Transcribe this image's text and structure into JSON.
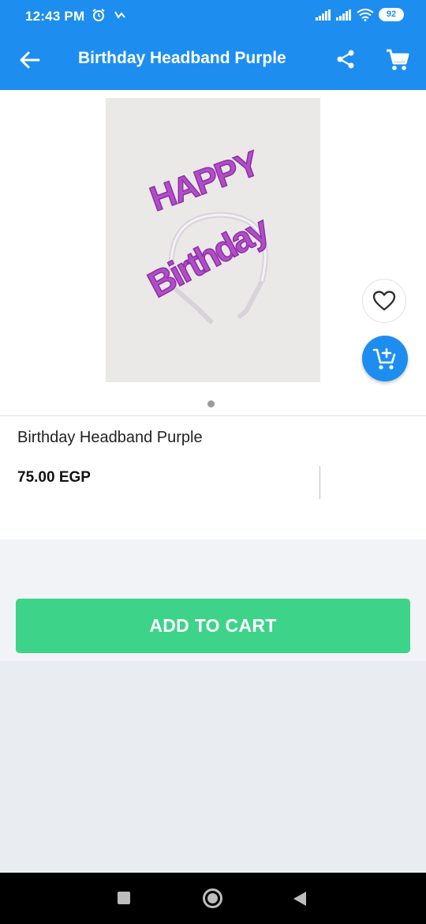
{
  "status_bar": {
    "time": "12:43 PM",
    "battery": "92",
    "icons": [
      "alarm-icon",
      "wifi-calling-icon",
      "signal-icon",
      "signal-icon",
      "wifi-icon",
      "battery-icon"
    ]
  },
  "app_bar": {
    "title": "Birthday Headband Purple",
    "icons": [
      "back-arrow-icon",
      "share-icon",
      "shopping-cart-icon"
    ]
  },
  "product": {
    "image_text": [
      "HAPPY",
      "Birthday"
    ],
    "name": "Birthday Headband Purple",
    "price": "75.00 EGP",
    "carousel": {
      "pages": 1,
      "current": 1
    },
    "actions": [
      "heart-icon",
      "add-to-cart-icon"
    ]
  },
  "cart_section": {
    "button_label": "ADD TO CART"
  },
  "colors": {
    "primary": "#1d8ef0",
    "add_to_cart": "#3dd48a",
    "headband_purple": "#b04ec8"
  },
  "navigation_bar": {
    "icons": [
      "recent-apps-icon",
      "home-icon",
      "back-icon"
    ]
  }
}
